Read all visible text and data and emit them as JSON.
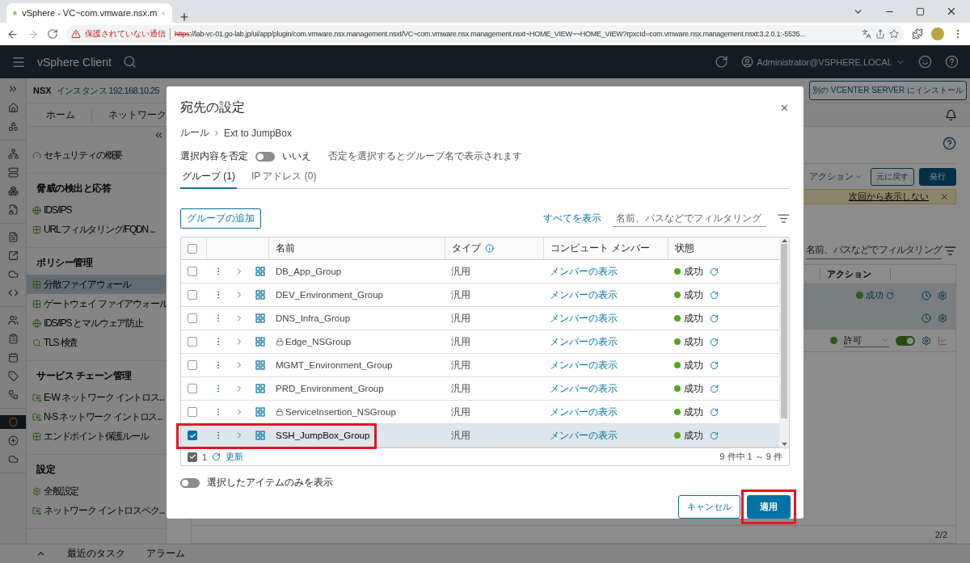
{
  "browser": {
    "tab_title": "vSphere - VC~com.vmware.nsx.m",
    "security_warning": "保護されていない通信",
    "url_scheme": "https",
    "url_rest": "://lab-vc-01.go-lab.jp/ui/app/plugin/com.vmware.nsx.management.nsxt/VC~com.vmware.nsx.management.nsxt~HOME_VIEW~~HOME_VIEW?rpxcId=com.vmware.nsx.management.nsxt:3.2.0.1:-5535..."
  },
  "app_header": {
    "title": "vSphere Client",
    "user": "Administrator@VSPHERE.LOCAL"
  },
  "nsx_bar": {
    "product": "NSX",
    "instance": "インスタンス 192.168.10.25",
    "install_button": "別の VCENTER SERVER にインストール"
  },
  "top_tabs": [
    {
      "label": "ホーム",
      "selected": false
    },
    {
      "label": "ネットワーク",
      "selected": false
    }
  ],
  "nav_sections": [
    {
      "items": [
        {
          "label": "セキュリティの概要",
          "selected": false
        }
      ]
    },
    {
      "heading": "脅威の検出と応答",
      "items": [
        {
          "label": "IDS/IPS",
          "selected": false
        },
        {
          "label": "URL フィルタリング/FQDN ...",
          "selected": false
        }
      ]
    },
    {
      "heading": "ポリシー管理",
      "items": [
        {
          "label": "分散ファイアウォール",
          "selected": true
        },
        {
          "label": "ゲートウェイ ファイアウォール",
          "selected": false
        },
        {
          "label": "IDS/IPS とマルウェア防止",
          "selected": false
        },
        {
          "label": "TLS 検査",
          "selected": false
        }
      ]
    },
    {
      "heading": "サービス チェーン管理",
      "items": [
        {
          "label": "E-W ネットワーク イントロス...",
          "selected": false
        },
        {
          "label": "N-S ネットワーク イントロス...",
          "selected": false
        },
        {
          "label": "エンドポイント保護ルール",
          "selected": false
        }
      ]
    },
    {
      "heading": "設定",
      "items": [
        {
          "label": "全般設定",
          "selected": false
        },
        {
          "label": "ネットワーク イントロスペク...",
          "selected": false
        }
      ]
    }
  ],
  "background": {
    "actions_menu": "アクション",
    "revert_button": "元に戻す",
    "publish_button": "発行",
    "banner_link": "次回から表示しない",
    "filter_placeholder": "名前、パスなどでフィルタリング",
    "column_header": "アクション",
    "row_status": "成功",
    "rule_action": "許可",
    "rule_enabled": true,
    "pager": "2/2"
  },
  "bottom_bar": {
    "tabs": [
      "最近のタスク",
      "アラーム"
    ]
  },
  "dialog": {
    "title": "宛先の設定",
    "breadcrumb": [
      "ルール",
      "Ext to JumpBox"
    ],
    "negate_label": "選択内容を否定",
    "negate_on": false,
    "negate_value": "いいえ",
    "negate_hint": "否定を選択するとグループ名で表示されます",
    "tabs": [
      {
        "label": "グループ (1)",
        "selected": true
      },
      {
        "label": "IP アドレス (0)",
        "selected": false
      }
    ],
    "add_button": "グループの追加",
    "show_all_link": "すべてを表示",
    "filter_placeholder": "名前、パスなどでフィルタリング",
    "select_all_checked": false,
    "columns": [
      "名前",
      "タイプ",
      "コンピュート メンバー",
      "状態"
    ],
    "rows": [
      {
        "name": "DB_App_Group",
        "locked": false,
        "type": "汎用",
        "members": "メンバーの表示",
        "status": "成功",
        "selected": false,
        "annotated": false
      },
      {
        "name": "DEV_Environment_Group",
        "locked": false,
        "type": "汎用",
        "members": "メンバーの表示",
        "status": "成功",
        "selected": false,
        "annotated": false
      },
      {
        "name": "DNS_Infra_Group",
        "locked": false,
        "type": "汎用",
        "members": "メンバーの表示",
        "status": "成功",
        "selected": false,
        "annotated": false
      },
      {
        "name": "Edge_NSGroup",
        "locked": true,
        "type": "汎用",
        "members": "メンバーの表示",
        "status": "成功",
        "selected": false,
        "annotated": false
      },
      {
        "name": "MGMT_Environment_Group",
        "locked": false,
        "type": "汎用",
        "members": "メンバーの表示",
        "status": "成功",
        "selected": false,
        "annotated": false
      },
      {
        "name": "PRD_Environment_Group",
        "locked": false,
        "type": "汎用",
        "members": "メンバーの表示",
        "status": "成功",
        "selected": false,
        "annotated": false
      },
      {
        "name": "ServiceInsertion_NSGroup",
        "locked": true,
        "type": "汎用",
        "members": "メンバーの表示",
        "status": "成功",
        "selected": false,
        "annotated": false
      },
      {
        "name": "SSH_JumpBox_Group",
        "locked": false,
        "type": "汎用",
        "members": "メンバーの表示",
        "status": "成功",
        "selected": true,
        "annotated": true
      }
    ],
    "footer_checked": true,
    "selected_count": "1",
    "refresh_label": "更新",
    "range": "9 件中 1 ～ 9 件",
    "only_selected_label": "選択したアイテムのみを表示",
    "only_selected_on": false,
    "cancel_button": "キャンセル",
    "apply_button": {
      "label": "適用",
      "annotated": true
    }
  }
}
